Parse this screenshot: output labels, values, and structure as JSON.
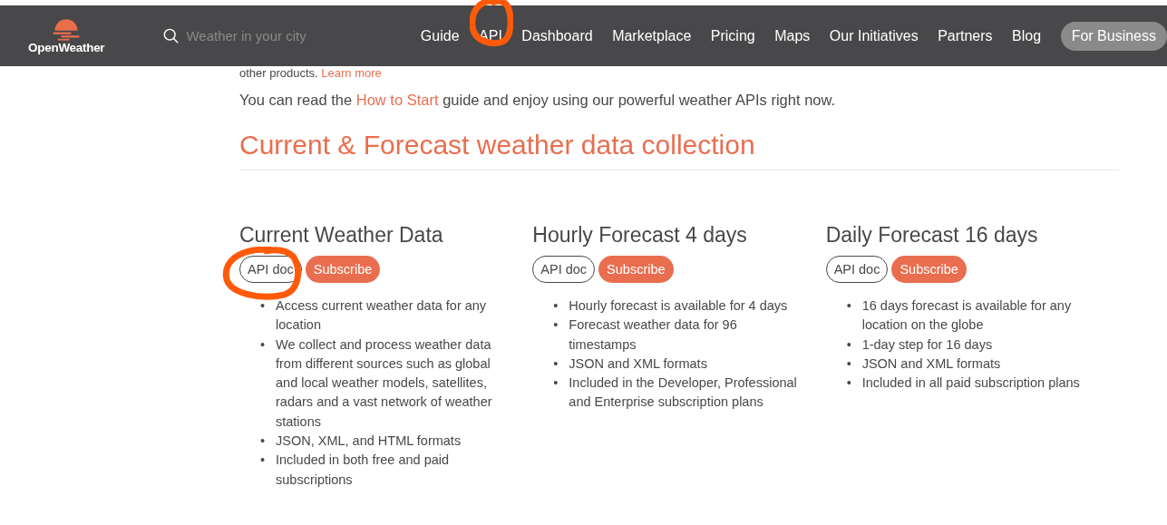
{
  "header": {
    "logo_text": "OpenWeather",
    "search": {
      "placeholder": "Weather in your city"
    },
    "nav": [
      {
        "label": "Guide",
        "circled": false
      },
      {
        "label": "API",
        "circled": true
      },
      {
        "label": "Dashboard",
        "circled": false
      },
      {
        "label": "Marketplace",
        "circled": false
      },
      {
        "label": "Pricing",
        "circled": false
      },
      {
        "label": "Maps",
        "circled": false
      },
      {
        "label": "Our Initiatives",
        "circled": false
      },
      {
        "label": "Partners",
        "circled": false
      },
      {
        "label": "Blog",
        "circled": false
      }
    ],
    "business_button": "For Business"
  },
  "intro": [
    {
      "text": "other products.",
      "link": "Learn more"
    },
    {
      "text": "You can read the",
      "link": "How to Start",
      "after": "guide and enjoy using our powerful weather APIs right now."
    }
  ],
  "section_title": "Current & Forecast weather data collection",
  "products": [
    {
      "title": "Current Weather Data",
      "doc_button": "API doc",
      "doc_circled": true,
      "subscribe_button": "Subscribe",
      "features": [
        {
          "marker": "•",
          "text": "Access current weather data for any location"
        },
        {
          "marker": "•",
          "text": "We collect and process weather data from different sources such as global and local weather models, satellites, radars and a vast network of weather stations"
        },
        {
          "marker": "•",
          "text": "JSON, XML, and HTML formats"
        },
        {
          "marker": "•",
          "text": "Included in both free and paid subscriptions"
        }
      ]
    },
    {
      "title": "Hourly Forecast 4 days",
      "doc_button": "API doc",
      "doc_circled": false,
      "subscribe_button": "Subscribe",
      "features": [
        {
          "marker": "•",
          "text": "Hourly forecast is available for 4 days"
        },
        {
          "marker": "•",
          "text": "Forecast weather data for 96 timestamps"
        },
        {
          "marker": "•",
          "text": "JSON and XML formats"
        },
        {
          "marker": "•",
          "text": "Included in the Developer, Professional and Enterprise subscription plans"
        }
      ]
    },
    {
      "title": "Daily Forecast 16 days",
      "doc_button": "API doc",
      "doc_circled": false,
      "subscribe_button": "Subscribe",
      "features": [
        {
          "marker": "•",
          "text": "16 days forecast is available for any location on the globe"
        },
        {
          "marker": "•",
          "text": "1-day step for 16 days"
        },
        {
          "marker": "•",
          "text": "JSON and XML formats"
        },
        {
          "marker": "•",
          "text": "Included in all paid subscription plans"
        }
      ]
    }
  ]
}
